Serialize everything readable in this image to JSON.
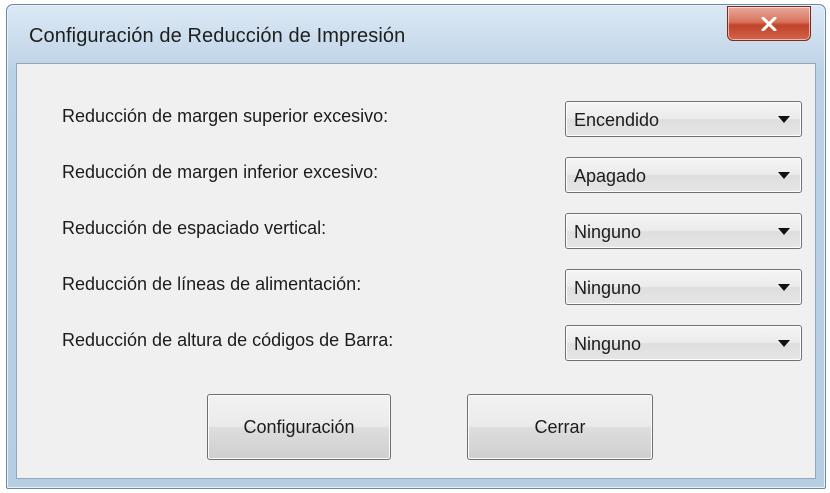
{
  "window": {
    "title": "Configuración de Reducción de Impresión",
    "close_icon": "close-icon",
    "close_color": "#c7472e"
  },
  "settings": [
    {
      "label": "Reducción de margen superior excesivo:",
      "value": "Encendido"
    },
    {
      "label": "Reducción de margen inferior excesivo:",
      "value": "Apagado"
    },
    {
      "label": "Reducción de espaciado vertical:",
      "value": "Ninguno"
    },
    {
      "label": "Reducción de líneas de alimentación:",
      "value": "Ninguno"
    },
    {
      "label": "Reducción de altura de códigos de Barra:",
      "value": "Ninguno"
    }
  ],
  "buttons": {
    "configure": "Configuración",
    "close": "Cerrar"
  }
}
